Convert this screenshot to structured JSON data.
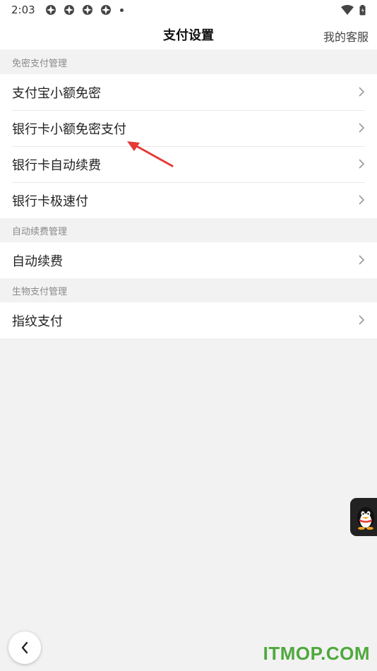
{
  "status_bar": {
    "time": "2:03"
  },
  "header": {
    "title": "支付设置",
    "right_link": "我的客服"
  },
  "sections": [
    {
      "title": "免密支付管理",
      "items": [
        "支付宝小额免密",
        "银行卡小额免密支付",
        "银行卡自动续费",
        "银行卡极速付"
      ]
    },
    {
      "title": "自动续费管理",
      "items": [
        "自动续费"
      ]
    },
    {
      "title": "生物支付管理",
      "items": [
        "指纹支付"
      ]
    }
  ],
  "watermark": "ITMOP.COM",
  "colors": {
    "annotation_arrow": "#e53935",
    "watermark": "#4fa83d",
    "background": "#f2f2f2"
  }
}
